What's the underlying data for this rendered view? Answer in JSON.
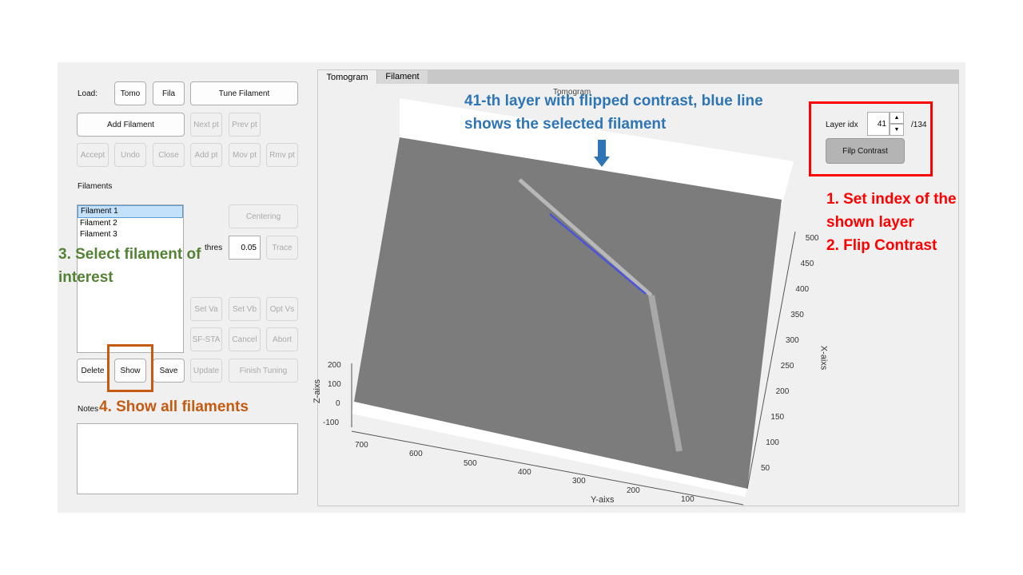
{
  "left": {
    "load_label": "Load:",
    "tomo": "Tomo",
    "fila": "Fila",
    "tune": "Tune Filament",
    "add_filament": "Add Filament",
    "next_pt": "Next pt",
    "prev_pt": "Prev pt",
    "accept": "Accept",
    "undo": "Undo",
    "close": "Close",
    "add_pt": "Add pt",
    "mov_pt": "Mov pt",
    "rmv_pt": "Rmv pt",
    "filaments_label": "Filaments",
    "filaments": [
      "Filament 1",
      "Filament 2",
      "Filament 3"
    ],
    "selected_filament": "Filament 1",
    "centering": "Centering",
    "thres_label": "thres",
    "thres_value": "0.05",
    "trace": "Trace",
    "set_va": "Set Va",
    "set_vb": "Set Vb",
    "opt_vs": "Opt Vs",
    "sf_sta": "SF-STA",
    "cancel": "Cancel",
    "abort": "Abort",
    "delete": "Delete",
    "show": "Show",
    "save": "Save",
    "update": "Update",
    "finish_tuning": "Finish Tuning",
    "notes_label": "Notes",
    "notes_value": ""
  },
  "tabs": [
    {
      "label": "Tomogram",
      "active": true
    },
    {
      "label": "Filament",
      "active": false
    }
  ],
  "plot": {
    "title": "Tomogram",
    "xlabel": "X-aixs",
    "ylabel": "Y-aixs",
    "zlabel": "Z-aixs",
    "y_ticks": [
      "700",
      "600",
      "500",
      "400",
      "300",
      "200",
      "100"
    ],
    "x_ticks": [
      "50",
      "100",
      "150",
      "200",
      "250",
      "300",
      "350",
      "400",
      "450",
      "500"
    ],
    "z_ticks": [
      "200",
      "100",
      "0",
      "-100"
    ]
  },
  "layer": {
    "label": "Layer idx",
    "value": "41",
    "total": "/134",
    "flip": "Filp Contrast"
  },
  "annotations": {
    "a1": "41-th layer with flipped contrast, blue line shows the selected filament",
    "a2_1": "1. Set index of the shown layer",
    "a2_2": "2. Flip Contrast",
    "a3": "3. Select filament of interest",
    "a4": "4. Show all filaments"
  },
  "colors": {
    "blue": "#2e75b6",
    "red": "#ff0000",
    "green": "#548235",
    "orange": "#c55a11"
  }
}
